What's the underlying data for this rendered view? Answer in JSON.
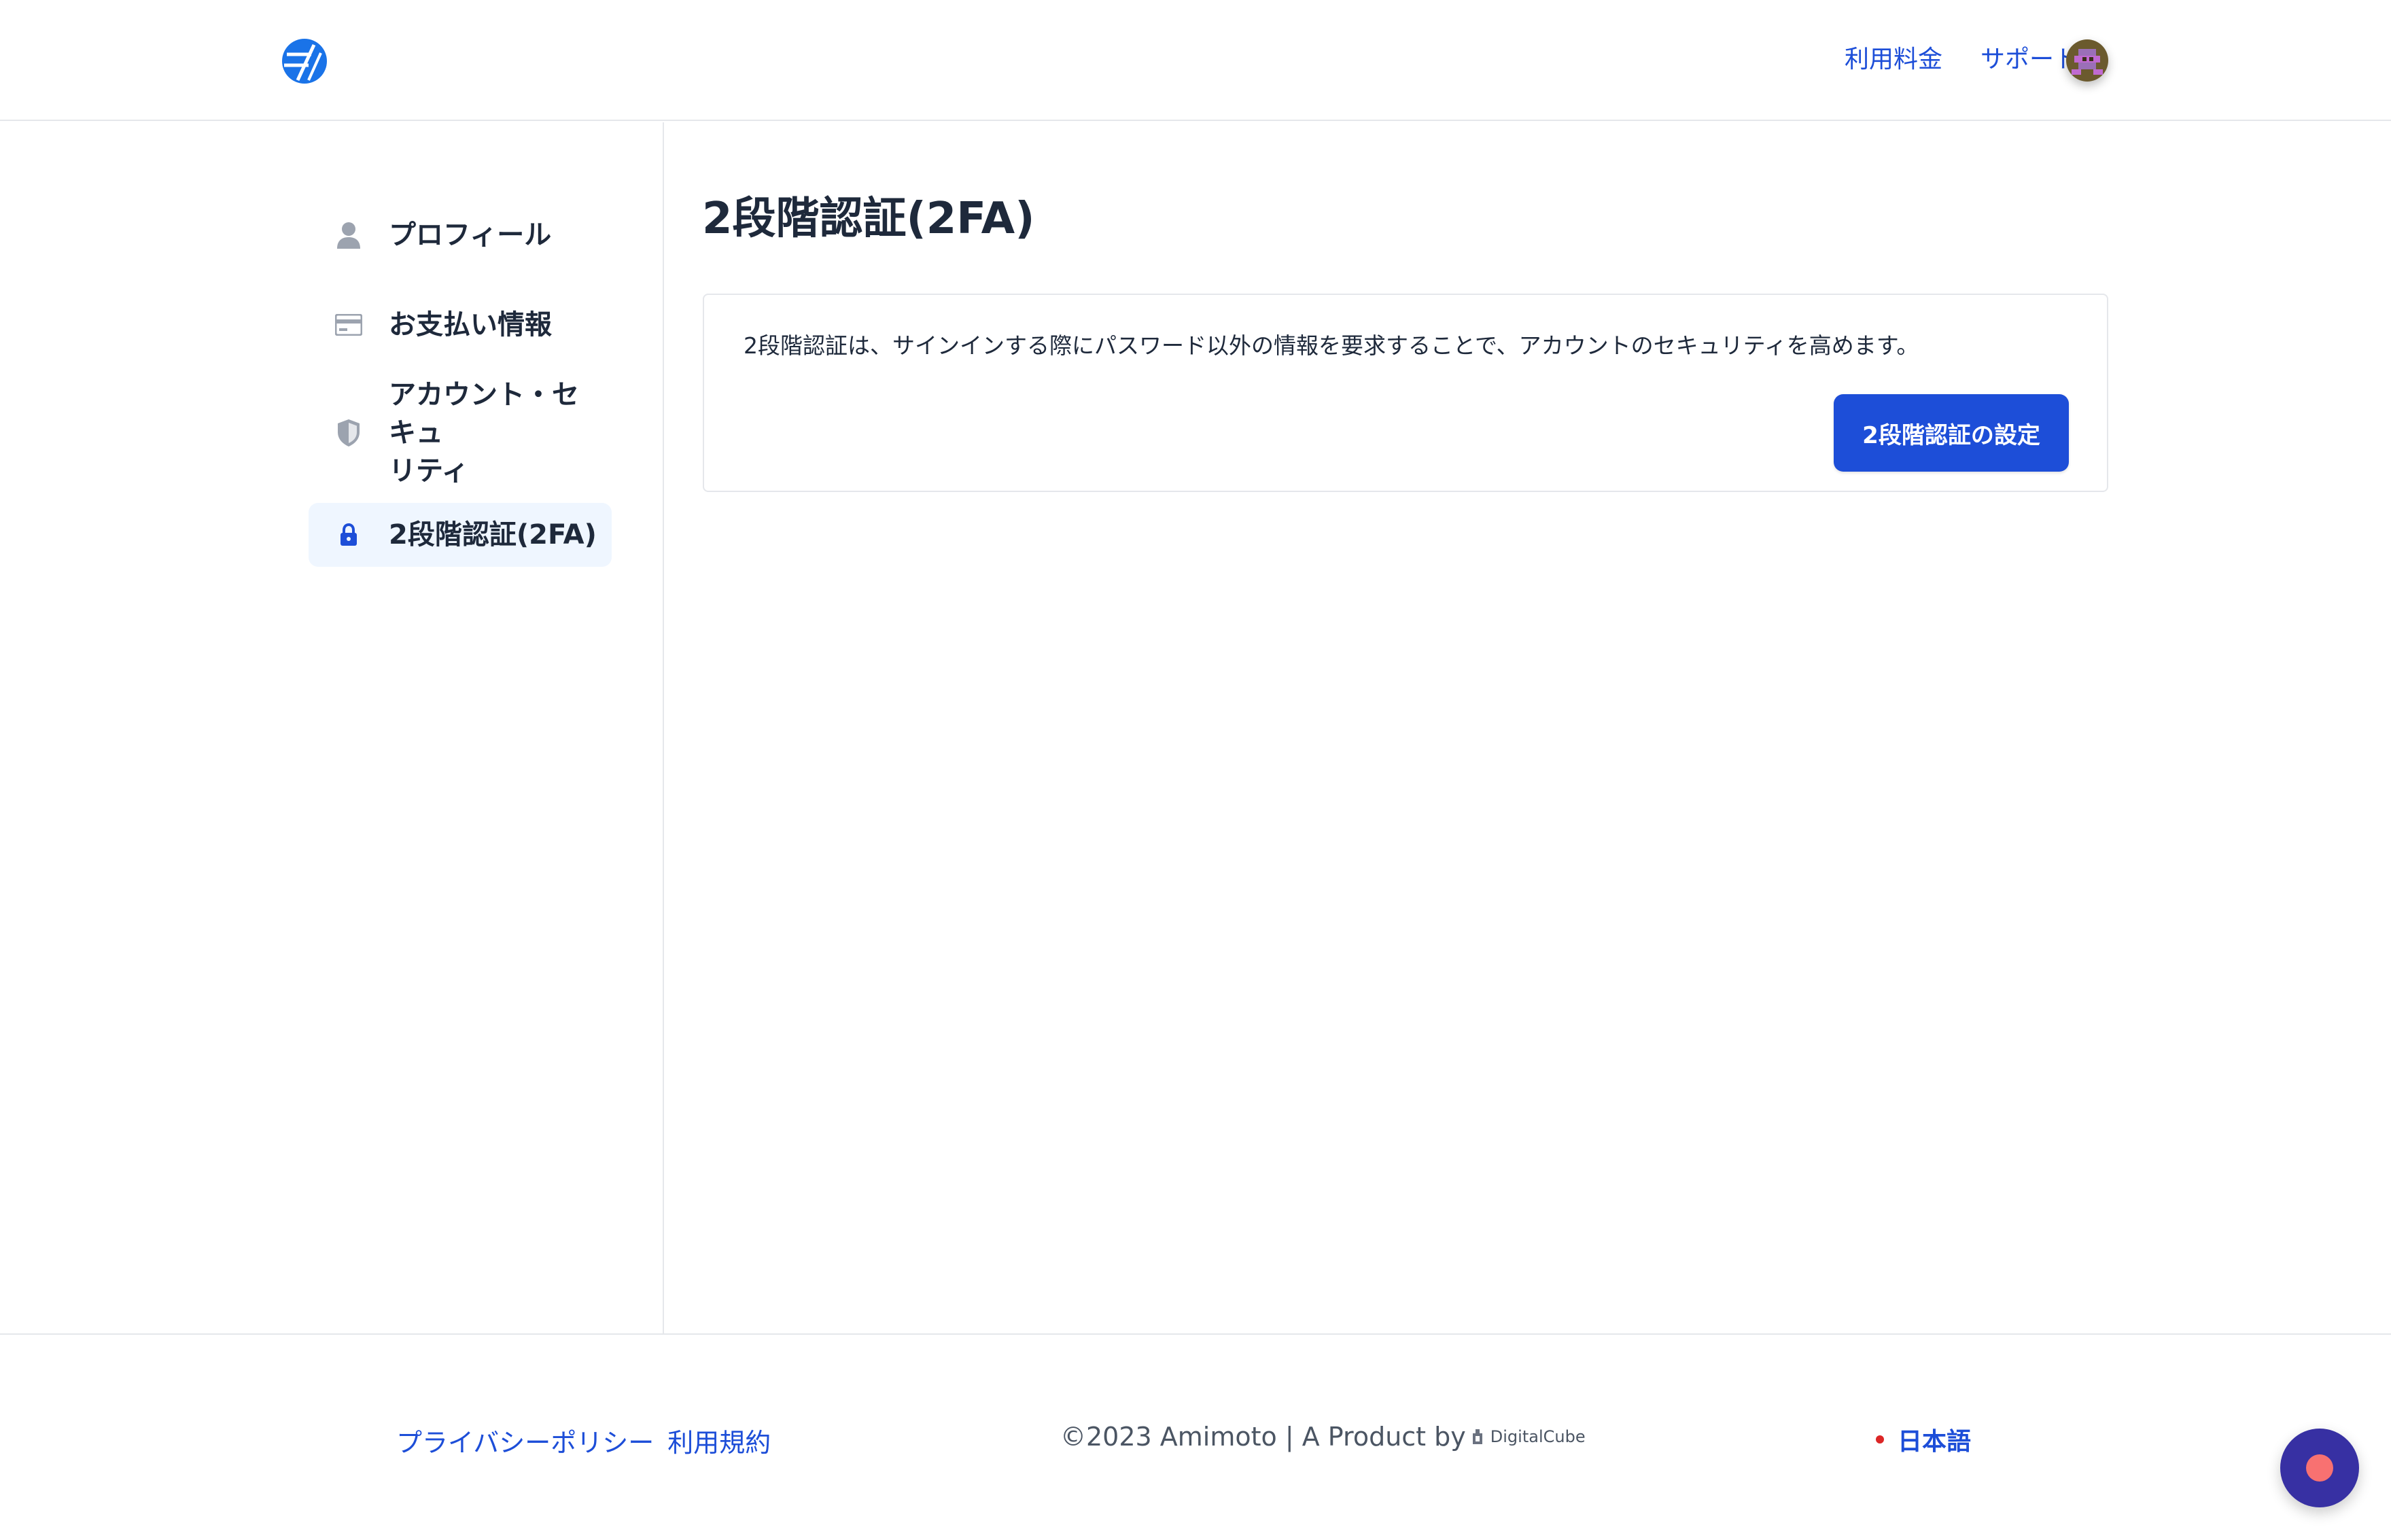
{
  "header": {
    "logo_icon": "amimoto-logo-icon",
    "nav": [
      {
        "label": "利用料金"
      },
      {
        "label": "サポート"
      }
    ],
    "avatar_icon": "user-avatar"
  },
  "sidebar": {
    "items": [
      {
        "label": "プロフィール",
        "icon": "user-icon",
        "active": false
      },
      {
        "label": "お支払い情報",
        "icon": "credit-card-icon",
        "active": false
      },
      {
        "label_line1": "アカウント・セキュ",
        "label_line2": "リティ",
        "icon": "shield-icon",
        "active": false
      },
      {
        "label": "2段階認証(2FA)",
        "icon": "lock-icon",
        "active": true
      }
    ]
  },
  "main": {
    "title": "2段階認証(2FA)",
    "card": {
      "description": "2段階認証は、サインインする際にパスワード以外の情報を要求することで、アカウントのセキュリティを高めます。",
      "button_label": "2段階認証の設定"
    }
  },
  "footer": {
    "links": [
      {
        "label": "プライバシーポリシー"
      },
      {
        "label": "利用規約"
      }
    ],
    "copyright": "©2023 Amimoto | A Product by",
    "brand": "DigitalCube",
    "language": "日本語"
  },
  "colors": {
    "accent": "#1d4ed8",
    "active_bg": "#eff6ff",
    "text": "#1e293b",
    "border": "#e5e7eb",
    "chat": "#3730a3"
  }
}
